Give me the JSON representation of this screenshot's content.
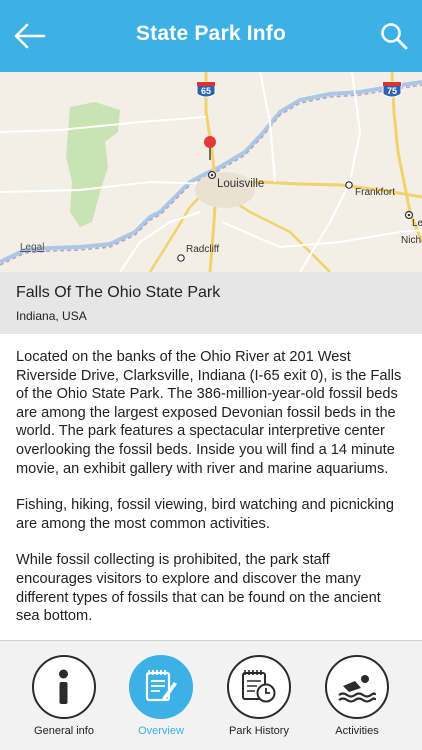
{
  "header": {
    "title": "State Park Info",
    "back_icon": "arrow-left-icon",
    "search_icon": "search-icon"
  },
  "map": {
    "labels": {
      "louisville": "Louisville",
      "frankfort": "Frankfort",
      "radcliff": "Radcliff",
      "legal": "Legal",
      "le": "Le",
      "nich": "Nich"
    },
    "shields": {
      "i65": "65",
      "i75": "75"
    },
    "pin_color": "#e53935"
  },
  "park": {
    "name": "Falls Of The Ohio State Park",
    "location": "Indiana, USA"
  },
  "description": {
    "p1": "Located on the banks of the Ohio River at 201 West Riverside Drive, Clarksville, Indiana (I-65 exit 0), is the Falls of the Ohio State Park. The 386-million-year-old fossil beds are among the largest exposed Devonian fossil beds in the world. The park features a spectacular interpretive center overlooking the fossil beds. Inside you will find a 14 minute movie, an exhibit gallery with river and marine aquariums.",
    "p2": "Fishing, hiking, fossil viewing, bird watching and picnicking are among the most common activities.",
    "p3": "While fossil collecting is prohibited, the park staff encourages visitors to explore and discover the many different types of fossils that can be found on the ancient sea bottom."
  },
  "tabs": [
    {
      "label": "General info",
      "icon": "info-icon",
      "active": false
    },
    {
      "label": "Overview",
      "icon": "notepad-pen-icon",
      "active": true
    },
    {
      "label": "Park History",
      "icon": "history-clock-icon",
      "active": false
    },
    {
      "label": "Activities",
      "icon": "swimmer-icon",
      "active": false
    }
  ],
  "colors": {
    "accent": "#3db1e6",
    "header_bg": "#3db1e6",
    "info_bar_bg": "#e6e6e6",
    "tabbar_bg": "#f2f2f2"
  }
}
